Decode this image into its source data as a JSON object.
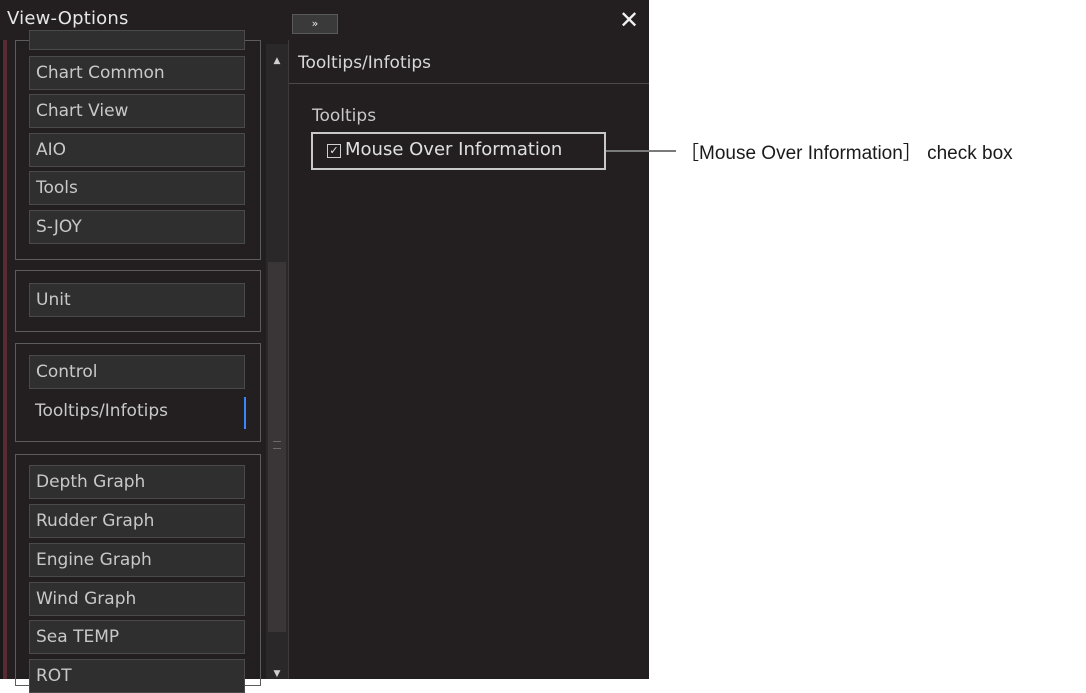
{
  "window": {
    "title": "View-Options",
    "expand_label": "»",
    "close_label": "✕"
  },
  "sidebar": {
    "groups": [
      {
        "items": [
          "Chart Common",
          "Chart View",
          "AIO",
          "Tools",
          "S-JOY"
        ]
      },
      {
        "items": [
          "Unit"
        ]
      },
      {
        "items": [
          "Control",
          "Tooltips/Infotips"
        ],
        "selected": "Tooltips/Infotips"
      },
      {
        "items": [
          "Depth Graph",
          "Rudder Graph",
          "Engine Graph",
          "Wind Graph",
          "Sea TEMP",
          "ROT"
        ]
      }
    ],
    "scroll_up": "▲",
    "scroll_down": "▼"
  },
  "main": {
    "title": "Tooltips/Infotips",
    "section": "Tooltips",
    "checkbox": {
      "label": "Mouse Over Information",
      "checked": true,
      "mark": "✓"
    }
  },
  "annotation": {
    "text": "［Mouse Over Information］ check box"
  },
  "colors": {
    "panel_bg": "#231f20",
    "item_bg": "#2f2f2f",
    "selection_accent": "#3a86ff"
  }
}
